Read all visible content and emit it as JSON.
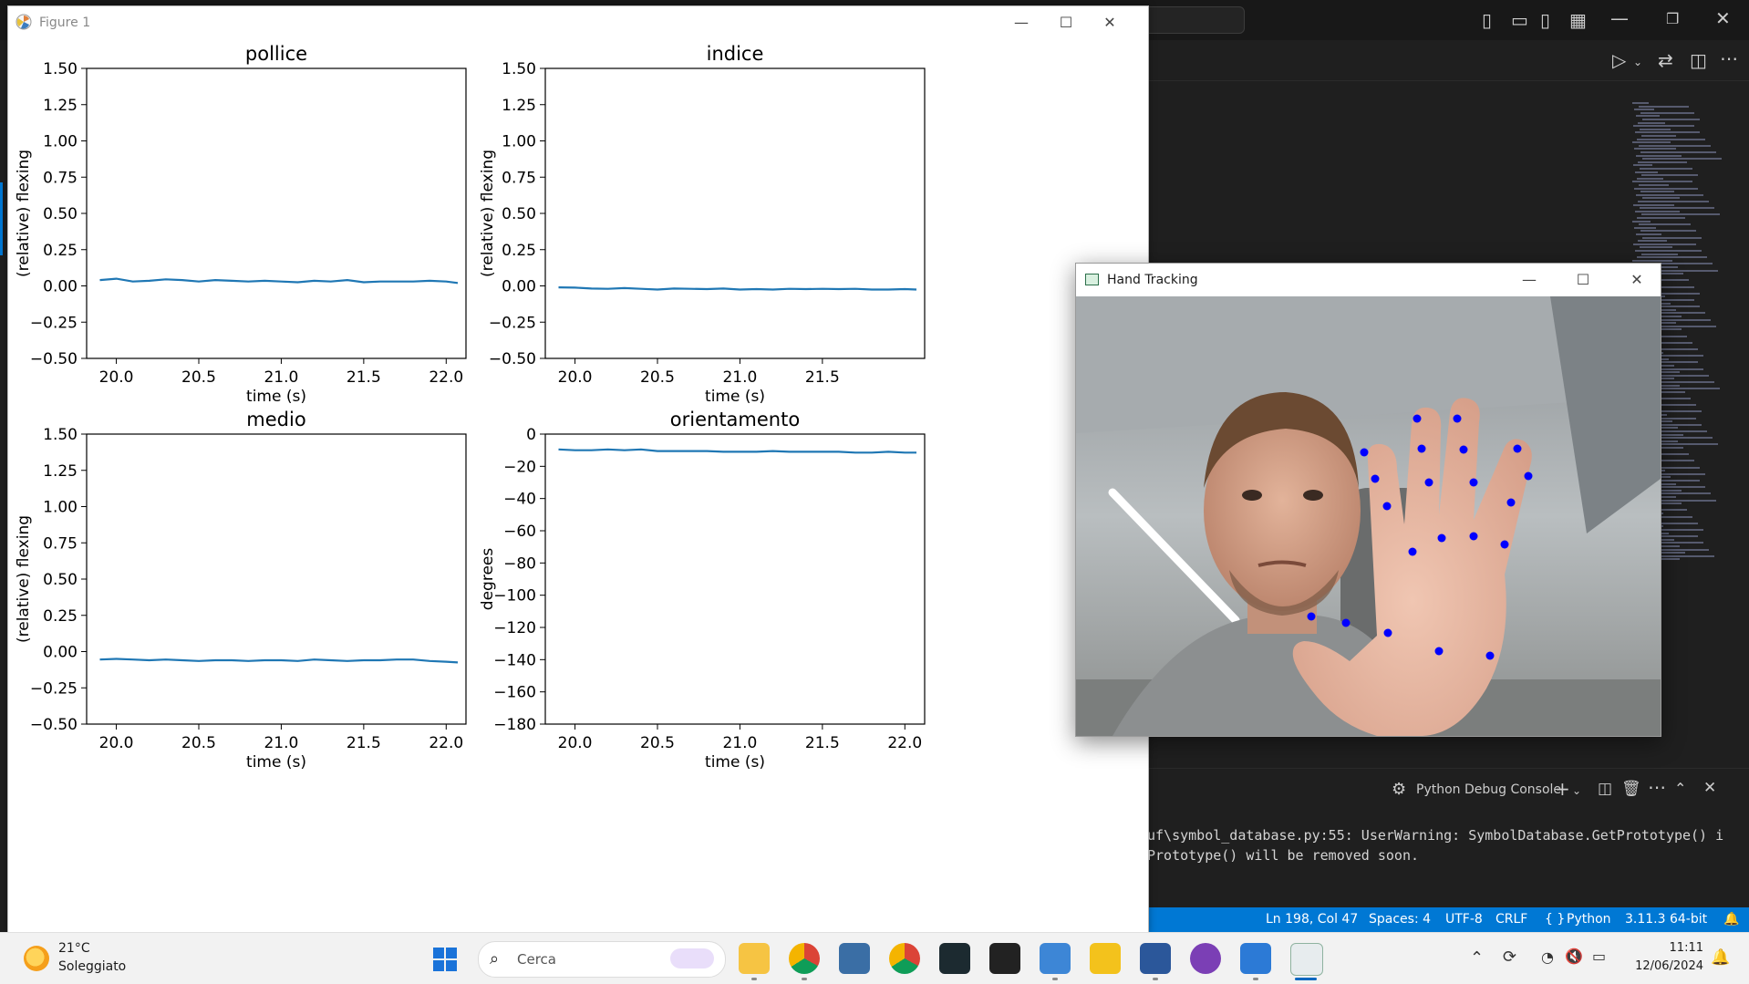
{
  "figure_window": {
    "title": "Figure 1",
    "minimize": "—",
    "maximize": "☐",
    "close": "✕"
  },
  "hand_window": {
    "title": "Hand Tracking",
    "minimize": "—",
    "maximize": "☐",
    "close": "✕",
    "landmark_color": "#0000ff"
  },
  "chart_data": [
    {
      "type": "line",
      "title": "pollice",
      "xlabel": "time (s)",
      "ylabel": "(relative) flexing",
      "xlim": [
        19.82,
        22.12
      ],
      "ylim": [
        -0.5,
        1.5
      ],
      "xticks": [
        "20.0",
        "20.5",
        "21.0",
        "21.5",
        "22.0"
      ],
      "xtick_values": [
        20.0,
        20.5,
        21.0,
        21.5,
        22.0
      ],
      "yticks": [
        "−0.50",
        "−0.25",
        "0.00",
        "0.25",
        "0.50",
        "0.75",
        "1.00",
        "1.25",
        "1.50"
      ],
      "ytick_values": [
        -0.5,
        -0.25,
        0.0,
        0.25,
        0.5,
        0.75,
        1.0,
        1.25,
        1.5
      ],
      "color": "#1f77b4",
      "x": [
        19.9,
        20.0,
        20.1,
        20.2,
        20.3,
        20.4,
        20.5,
        20.6,
        20.7,
        20.8,
        20.9,
        21.0,
        21.1,
        21.2,
        21.3,
        21.4,
        21.5,
        21.6,
        21.7,
        21.8,
        21.9,
        22.0,
        22.07
      ],
      "y": [
        0.04,
        0.05,
        0.03,
        0.035,
        0.045,
        0.04,
        0.03,
        0.04,
        0.035,
        0.03,
        0.035,
        0.03,
        0.025,
        0.035,
        0.03,
        0.04,
        0.025,
        0.03,
        0.03,
        0.03,
        0.035,
        0.03,
        0.02
      ]
    },
    {
      "type": "line",
      "title": "indice",
      "xlabel": "time (s)",
      "ylabel": "(relative) flexing",
      "xlim": [
        19.82,
        22.12
      ],
      "ylim": [
        -0.5,
        1.5
      ],
      "xticks": [
        "20.0",
        "20.5",
        "21.0",
        "21.5"
      ],
      "xtick_values": [
        20.0,
        20.5,
        21.0,
        21.5
      ],
      "yticks": [
        "−0.50",
        "−0.25",
        "0.00",
        "0.25",
        "0.50",
        "0.75",
        "1.00",
        "1.25",
        "1.50"
      ],
      "ytick_values": [
        -0.5,
        -0.25,
        0.0,
        0.25,
        0.5,
        0.75,
        1.0,
        1.25,
        1.5
      ],
      "color": "#1f77b4",
      "x": [
        19.9,
        20.0,
        20.1,
        20.2,
        20.3,
        20.4,
        20.5,
        20.6,
        20.7,
        20.8,
        20.9,
        21.0,
        21.1,
        21.2,
        21.3,
        21.4,
        21.5,
        21.6,
        21.7,
        21.8,
        21.9,
        22.0,
        22.07
      ],
      "y": [
        -0.01,
        -0.012,
        -0.018,
        -0.02,
        -0.015,
        -0.02,
        -0.025,
        -0.018,
        -0.02,
        -0.022,
        -0.018,
        -0.025,
        -0.022,
        -0.025,
        -0.02,
        -0.022,
        -0.02,
        -0.022,
        -0.02,
        -0.025,
        -0.025,
        -0.022,
        -0.025
      ]
    },
    {
      "type": "line",
      "title": "medio",
      "xlabel": "time (s)",
      "ylabel": "(relative) flexing",
      "xlim": [
        19.82,
        22.12
      ],
      "ylim": [
        -0.5,
        1.5
      ],
      "xticks": [
        "20.0",
        "20.5",
        "21.0",
        "21.5",
        "22.0"
      ],
      "xtick_values": [
        20.0,
        20.5,
        21.0,
        21.5,
        22.0
      ],
      "yticks": [
        "−0.50",
        "−0.25",
        "0.00",
        "0.25",
        "0.50",
        "0.75",
        "1.00",
        "1.25",
        "1.50"
      ],
      "ytick_values": [
        -0.5,
        -0.25,
        0.0,
        0.25,
        0.5,
        0.75,
        1.0,
        1.25,
        1.5
      ],
      "color": "#1f77b4",
      "x": [
        19.9,
        20.0,
        20.1,
        20.2,
        20.3,
        20.4,
        20.5,
        20.6,
        20.7,
        20.8,
        20.9,
        21.0,
        21.1,
        21.2,
        21.3,
        21.4,
        21.5,
        21.6,
        21.7,
        21.8,
        21.9,
        22.0,
        22.07
      ],
      "y": [
        -0.055,
        -0.05,
        -0.055,
        -0.06,
        -0.055,
        -0.06,
        -0.065,
        -0.06,
        -0.06,
        -0.065,
        -0.06,
        -0.06,
        -0.065,
        -0.055,
        -0.06,
        -0.065,
        -0.06,
        -0.06,
        -0.055,
        -0.055,
        -0.065,
        -0.07,
        -0.075
      ]
    },
    {
      "type": "line",
      "title": "orientamento",
      "xlabel": "time (s)",
      "ylabel": "degrees",
      "xlim": [
        19.82,
        22.12
      ],
      "ylim": [
        -180,
        0
      ],
      "xticks": [
        "20.0",
        "20.5",
        "21.0",
        "21.5",
        "22.0"
      ],
      "xtick_values": [
        20.0,
        20.5,
        21.0,
        21.5,
        22.0
      ],
      "yticks": [
        "−180",
        "−160",
        "−140",
        "−120",
        "−100",
        "−80",
        "−60",
        "−40",
        "−20",
        "0"
      ],
      "ytick_values": [
        -180,
        -160,
        -140,
        -120,
        -100,
        -80,
        -60,
        -40,
        -20,
        0
      ],
      "color": "#1f77b4",
      "x": [
        19.9,
        20.0,
        20.1,
        20.2,
        20.3,
        20.4,
        20.5,
        20.6,
        20.7,
        20.8,
        20.9,
        21.0,
        21.1,
        21.2,
        21.3,
        21.4,
        21.5,
        21.6,
        21.7,
        21.8,
        21.9,
        22.0,
        22.07
      ],
      "y": [
        -9.5,
        -10,
        -10,
        -9.5,
        -10,
        -9.5,
        -10.5,
        -10.5,
        -10.5,
        -10.5,
        -11,
        -11,
        -11,
        -10.5,
        -11,
        -11,
        -11,
        -11,
        -11.5,
        -11.5,
        -11,
        -11.5,
        -11.5
      ]
    }
  ],
  "vscode": {
    "debug_console": "Python Debug Console",
    "terminal_lines": [
      "uf\\symbol_database.py:55: UserWarning: SymbolDatabase.GetPrototype() i",
      "Prototype() will be removed soon."
    ],
    "status": {
      "position": "Ln 198, Col 47",
      "spaces": "Spaces: 4",
      "encoding": "UTF-8",
      "eol": "CRLF",
      "language": "Python",
      "interpreter": "3.11.3 64-bit"
    },
    "accent": "#0078d4"
  },
  "taskbar": {
    "weather_temp": "21°C",
    "weather_condition": "Soleggiato",
    "search_placeholder": "Cerca",
    "time": "11:11",
    "date": "12/06/2024"
  }
}
